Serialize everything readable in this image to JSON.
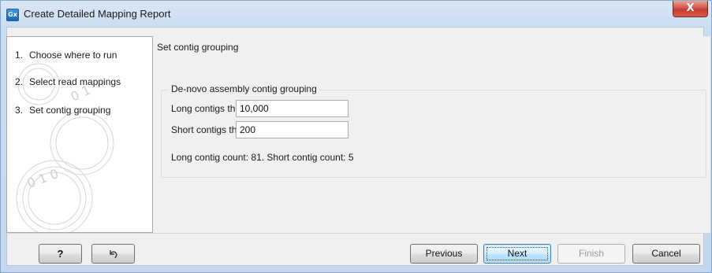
{
  "window": {
    "title": "Create Detailed Mapping Report",
    "icon_text": "Gx",
    "close_glyph": "X"
  },
  "steps": [
    {
      "num": "1.",
      "label": "Choose where to run"
    },
    {
      "num": "2.",
      "label": "Select read mappings"
    },
    {
      "num": "3.",
      "label": "Set contig grouping"
    }
  ],
  "content": {
    "section_title": "Set contig grouping",
    "group_title": "De-novo assembly contig grouping",
    "long_label": "Long contigs threshold",
    "long_value": "10,000",
    "short_label": "Short contigs threshold",
    "short_value": "200",
    "counts_text": "Long contig count: 81. Short contig count: 5"
  },
  "buttons": {
    "help": "?",
    "reset_icon": "undo-arrow-icon",
    "previous": "Previous",
    "next": "Next",
    "finish": "Finish",
    "cancel": "Cancel"
  },
  "colors": {
    "title_bar": "#c9dbf1",
    "close_button": "#c23a2d",
    "primary_button_border": "#3c7fb1"
  }
}
